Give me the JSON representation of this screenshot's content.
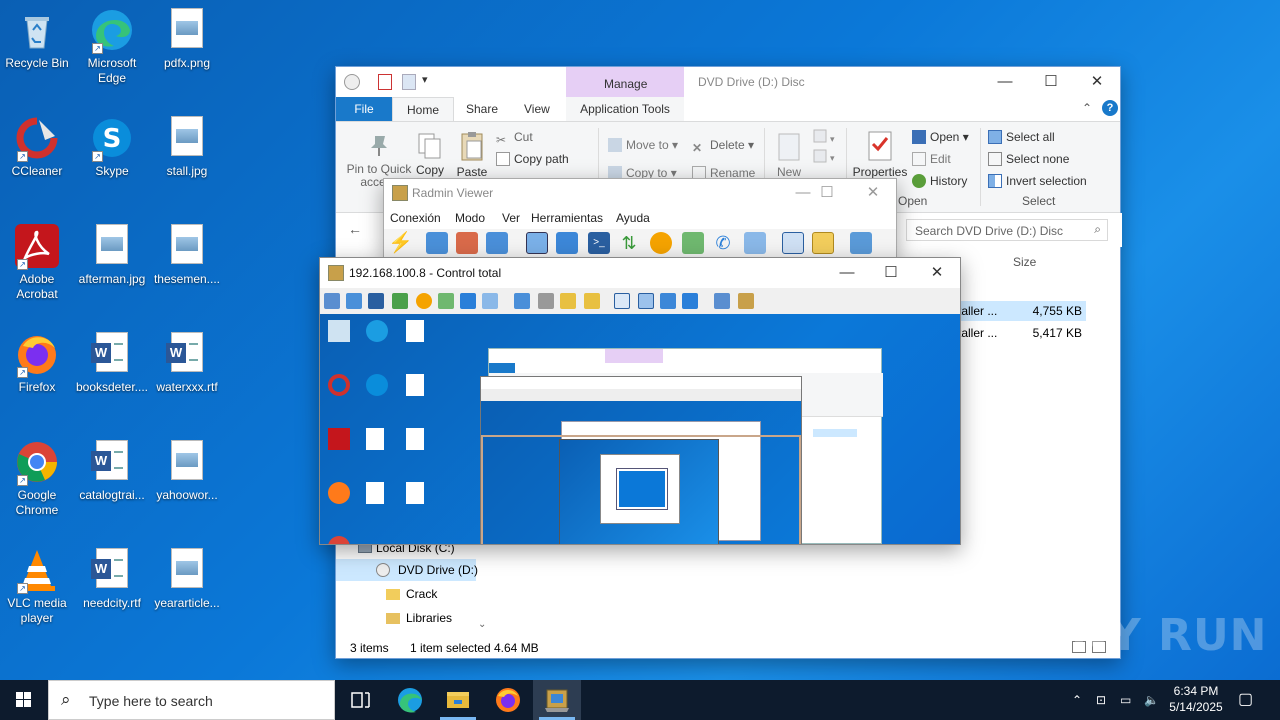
{
  "desktop": {
    "icons": [
      {
        "label": "Recycle Bin",
        "icon": "recycle-bin-icon"
      },
      {
        "label": "Microsoft Edge",
        "icon": "edge-icon"
      },
      {
        "label": "pdfx.png",
        "icon": "image-file-icon"
      },
      {
        "label": "CCleaner",
        "icon": "ccleaner-icon"
      },
      {
        "label": "Skype",
        "icon": "skype-icon"
      },
      {
        "label": "stall.jpg",
        "icon": "image-file-icon"
      },
      {
        "label": "Adobe Acrobat",
        "icon": "acrobat-icon"
      },
      {
        "label": "afterman.jpg",
        "icon": "image-file-icon"
      },
      {
        "label": "thesemen....",
        "icon": "image-file-icon"
      },
      {
        "label": "Firefox",
        "icon": "firefox-icon"
      },
      {
        "label": "booksdeter....",
        "icon": "word-file-icon"
      },
      {
        "label": "waterxxx.rtf",
        "icon": "word-file-icon"
      },
      {
        "label": "Google Chrome",
        "icon": "chrome-icon"
      },
      {
        "label": "catalogtrai...",
        "icon": "word-file-icon"
      },
      {
        "label": "yahoowor...",
        "icon": "image-file-icon"
      },
      {
        "label": "VLC media player",
        "icon": "vlc-icon"
      },
      {
        "label": "needcity.rtf",
        "icon": "word-file-icon"
      },
      {
        "label": "yeararticle...",
        "icon": "image-file-icon"
      }
    ]
  },
  "explorer": {
    "title": "DVD Drive (D:) Disc",
    "manage_tab": "Manage",
    "tabs": [
      "File",
      "Home",
      "Share",
      "View",
      "Application Tools"
    ],
    "ribbon": {
      "pin": "Pin to Quick access",
      "copy": "Copy",
      "paste": "Paste",
      "cut": "Cut",
      "copy_path": "Copy path",
      "move_to": "Move to",
      "copy_to": "Copy to",
      "delete": "Delete",
      "rename": "Rename",
      "new": "New",
      "properties": "Properties",
      "open": "Open",
      "edit": "Edit",
      "history": "History",
      "open_group": "Open",
      "select_all": "Select all",
      "select_none": "Select none",
      "invert_selection": "Invert selection",
      "select_group": "Select"
    },
    "search_placeholder": "Search DVD Drive (D:) Disc",
    "column_size": "Size",
    "files": [
      {
        "name": "taller ...",
        "size": "4,755 KB"
      },
      {
        "name": "taller ...",
        "size": "5,417 KB"
      }
    ],
    "nav": [
      {
        "label": "Local Disk (C:)"
      },
      {
        "label": "DVD Drive (D:)"
      },
      {
        "label": "Crack"
      },
      {
        "label": "Libraries"
      }
    ],
    "status": {
      "items": "3 items",
      "selected": "1 item selected",
      "size": "4.64 MB"
    }
  },
  "radmin": {
    "title": "Radmin Viewer",
    "menu": [
      "Conexión",
      "Modo",
      "Ver",
      "Herramientas",
      "Ayuda"
    ]
  },
  "control": {
    "title": "192.168.100.8 - Control total"
  },
  "taskbar": {
    "search_placeholder": "Type here to search",
    "time": "6:34 PM",
    "date": "5/14/2025"
  },
  "watermark": "ANY RUN"
}
